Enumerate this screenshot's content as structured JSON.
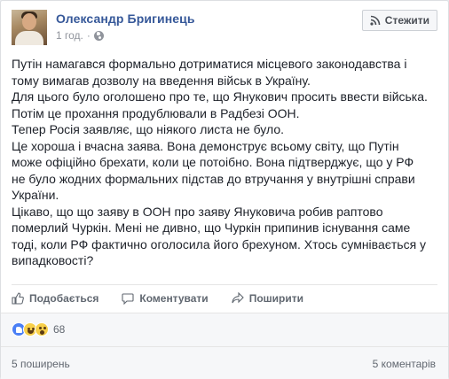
{
  "post": {
    "author": "Олександр Бригинець",
    "time": "1 год.",
    "separator": "·",
    "follow_label": "Стежити",
    "paragraphs": [
      "Путін намагався формально дотриматися місцевого законодавства і\nтому вимагав дозволу на введення військ в Україну.\nДля цього було оголошено про те, що Янукович просить ввести війська.\nПотім це прохання продублювали в Радбезі ООН.\nТепер Росія заявляє, що ніякого листа не було.\nЦе хороша і вчасна заява. Вона демонструє всьому світу, що Путін\nможе офіційно брехати, коли це потоібно. Вона підтверджує, що у РФ\nне було жодних формальних підстав до втручання у внутрішні справи\nУкраїни.\nЦікаво, що що заяву в ООН про заяву Януковича робив раптово\nпомерлий Чуркін. Мені не дивно, що Чуркін припинив існування саме\nтоді, коли РФ фактично оголосила його брехуном. Хтось сумнівається у\nвипадковості?"
    ]
  },
  "actions": {
    "like": "Подобається",
    "comment": "Коментувати",
    "share": "Поширити"
  },
  "stats": {
    "reactions_count": "68",
    "shares": "5 поширень",
    "comments": "5 коментарів"
  },
  "colors": {
    "link": "#365899",
    "like_reaction": "#4a7ff5",
    "emoji_yellow": "#f7cf4a"
  }
}
